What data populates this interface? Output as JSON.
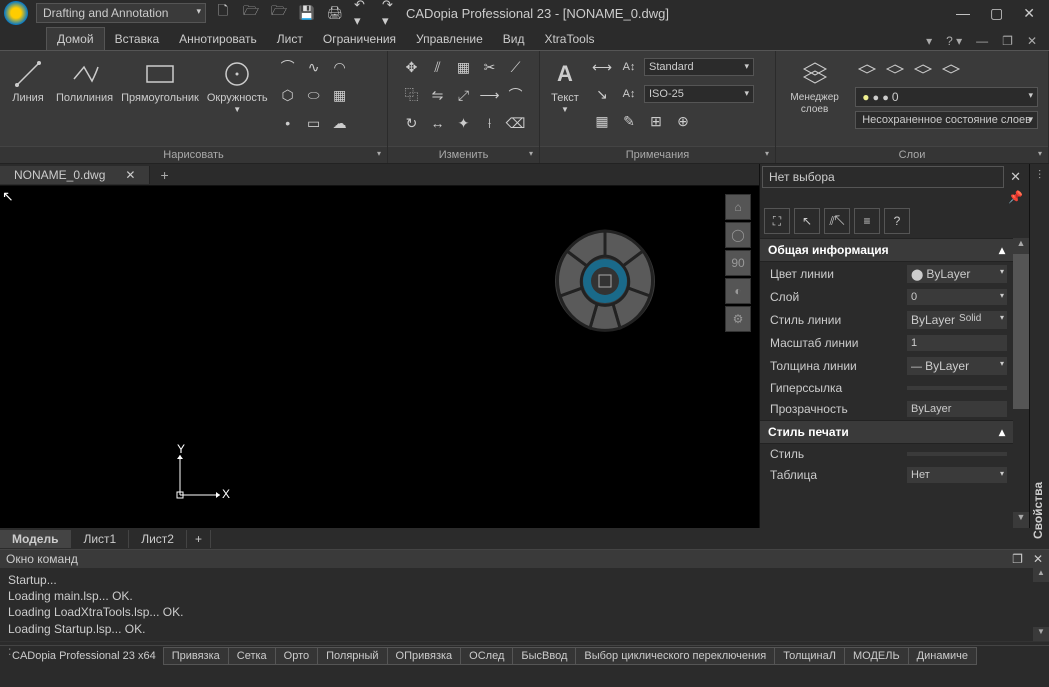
{
  "title": {
    "workspace": "Drafting and Annotation",
    "app": "CADopia Professional 23 - [NONAME_0.dwg]"
  },
  "menus": [
    "Домой",
    "Вставка",
    "Аннотировать",
    "Лист",
    "Ограничения",
    "Управление",
    "Вид",
    "XtraTools"
  ],
  "ribbon": {
    "draw": {
      "title": "Нарисовать",
      "line": "Линия",
      "polyline": "Полилиния",
      "rect": "Прямоугольник",
      "circle": "Окружность"
    },
    "modify": {
      "title": "Изменить"
    },
    "text": {
      "title": "Примечания",
      "btn": "Текст",
      "style": "Standard",
      "dim": "ISO-25"
    },
    "layers": {
      "title": "Слои",
      "btn": "Менеджер слоев",
      "current": "0",
      "state": "Несохраненное состояние слоев"
    }
  },
  "doctab": "NONAME_0.dwg",
  "viewtabs": [
    "Модель",
    "Лист1",
    "Лист2"
  ],
  "nav": {
    "deg": "90"
  },
  "props": {
    "selector": "Нет выбора",
    "sec1": "Общая информация",
    "rows1": {
      "linecolor": "Цвет линии",
      "linecolor_v": "ByLayer",
      "layer": "Слой",
      "layer_v": "0",
      "linestyle": "Стиль линии",
      "linestyle_v": "ByLayer",
      "linestyle_v2": "Solid",
      "linescale": "Масштаб линии",
      "linescale_v": "1",
      "lineweight": "Толщина линии",
      "lineweight_v": "ByLayer",
      "hyperlink": "Гиперссылка",
      "hyperlink_v": "",
      "transparency": "Прозрачность",
      "transparency_v": "ByLayer"
    },
    "sec2": "Стиль печати",
    "rows2": {
      "style": "Стиль",
      "style_v": "",
      "table": "Таблица",
      "table_v": "Нет"
    },
    "tab": "Свойства"
  },
  "cmd": {
    "title": "Окно команд",
    "lines": [
      "Startup...",
      "Loading main.lsp...  OK.",
      "Loading LoadXtraTools.lsp...  OK.",
      "Loading Startup.lsp...  OK."
    ],
    "prompt": ":"
  },
  "status": {
    "app": "CADopia Professional 23 x64",
    "items": [
      "Привязка",
      "Сетка",
      "Орто",
      "Полярный",
      "ОПривязка",
      "ОСлед",
      "БысВвод",
      "Выбор циклического переключения",
      "ТолщинаЛ",
      "МОДЕЛЬ",
      "Динамиче"
    ]
  }
}
